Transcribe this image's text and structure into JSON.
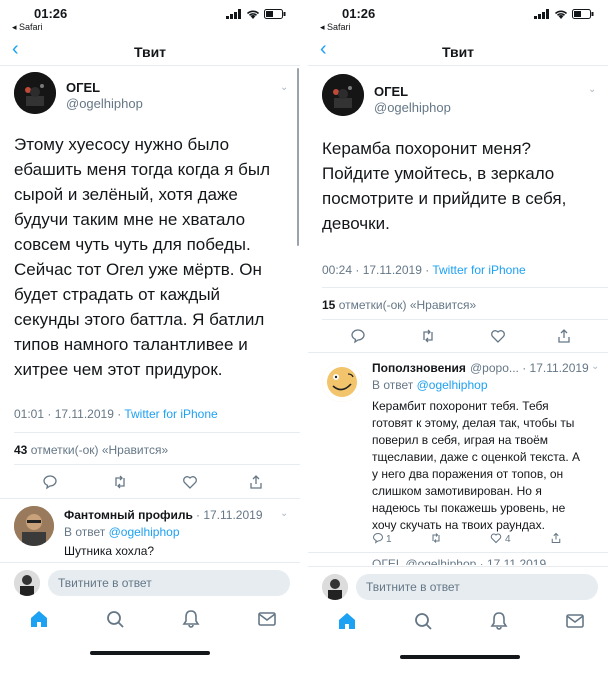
{
  "status": {
    "time": "01:26",
    "back_app": "◂ Safari"
  },
  "nav": {
    "title": "Твит"
  },
  "left": {
    "author": {
      "name": "OГEL",
      "handle": "@ogelhiphop"
    },
    "tweet_lines": [
      "Этому хуесосу нужно было",
      "ебашить меня тогда когда я был",
      "сырой и зелёный, хотя даже",
      "будучи таким мне не хватало",
      "совсем чуть чуть для победы.",
      "Сейчас тот Огел уже мёртв. Он",
      "будет страдать от каждый",
      "секунды этого баттла. Я батлил",
      "типов намного талантливее и",
      "хитрее чем этот придурок."
    ],
    "meta_time": "01:01 · 17.11.2019 · ",
    "meta_source": "Twitter for iPhone",
    "likes_count": "43",
    "likes_label": " отметки(-ок) «Нравится»",
    "reply": {
      "name": "Фантомный профиль",
      "date": "· 17.11.2019",
      "to_prefix": "В ответ ",
      "to_handle": "@ogelhiphop",
      "text": "Шутника хохла?"
    },
    "composer_placeholder": "Твитните в ответ"
  },
  "right": {
    "author": {
      "name": "OГEL",
      "handle": "@ogelhiphop"
    },
    "tweet_lines": [
      "Керамба похоронит меня?",
      "Пойдите умойтесь, в зеркало",
      "посмотрите и прийдите в себя,",
      "девочки."
    ],
    "meta_time": "00:24 · 17.11.2019 · ",
    "meta_source": "Twitter for iPhone",
    "likes_count": "15",
    "likes_label": " отметки(-ок) «Нравится»",
    "reply": {
      "name": "Поползновения",
      "handle_date": "@popo... · 17.11.2019",
      "to_prefix": "В ответ ",
      "to_handle": "@ogelhiphop",
      "text_lines": [
        "Керамбит похоронит тебя. Тебя",
        "готовят к этому, делая так, чтобы ты",
        "поверил в себя, играя на твоём",
        "тщеславии, даже с оценкой текста. А",
        "у него два поражения от топов, он",
        "слишком замотивирован. Но я",
        "надеюсь ты покажешь уровень, не",
        "хочу скучать на твоих раундах."
      ],
      "reply_count": "1",
      "like_count": "4"
    },
    "next_reply_peek": "OГEL @ogelhiphop · 17.11.2019",
    "composer_placeholder": "Твитните в ответ"
  },
  "colors": {
    "accent": "#1da1f2",
    "text": "#14171a",
    "muted": "#657786",
    "divider": "#e6ecf0"
  },
  "icons": [
    "chevron-left-icon",
    "signal-icon",
    "wifi-icon",
    "battery-icon",
    "reply-icon",
    "retweet-icon",
    "like-icon",
    "share-icon",
    "home-icon",
    "search-icon",
    "notifications-icon",
    "messages-icon"
  ]
}
